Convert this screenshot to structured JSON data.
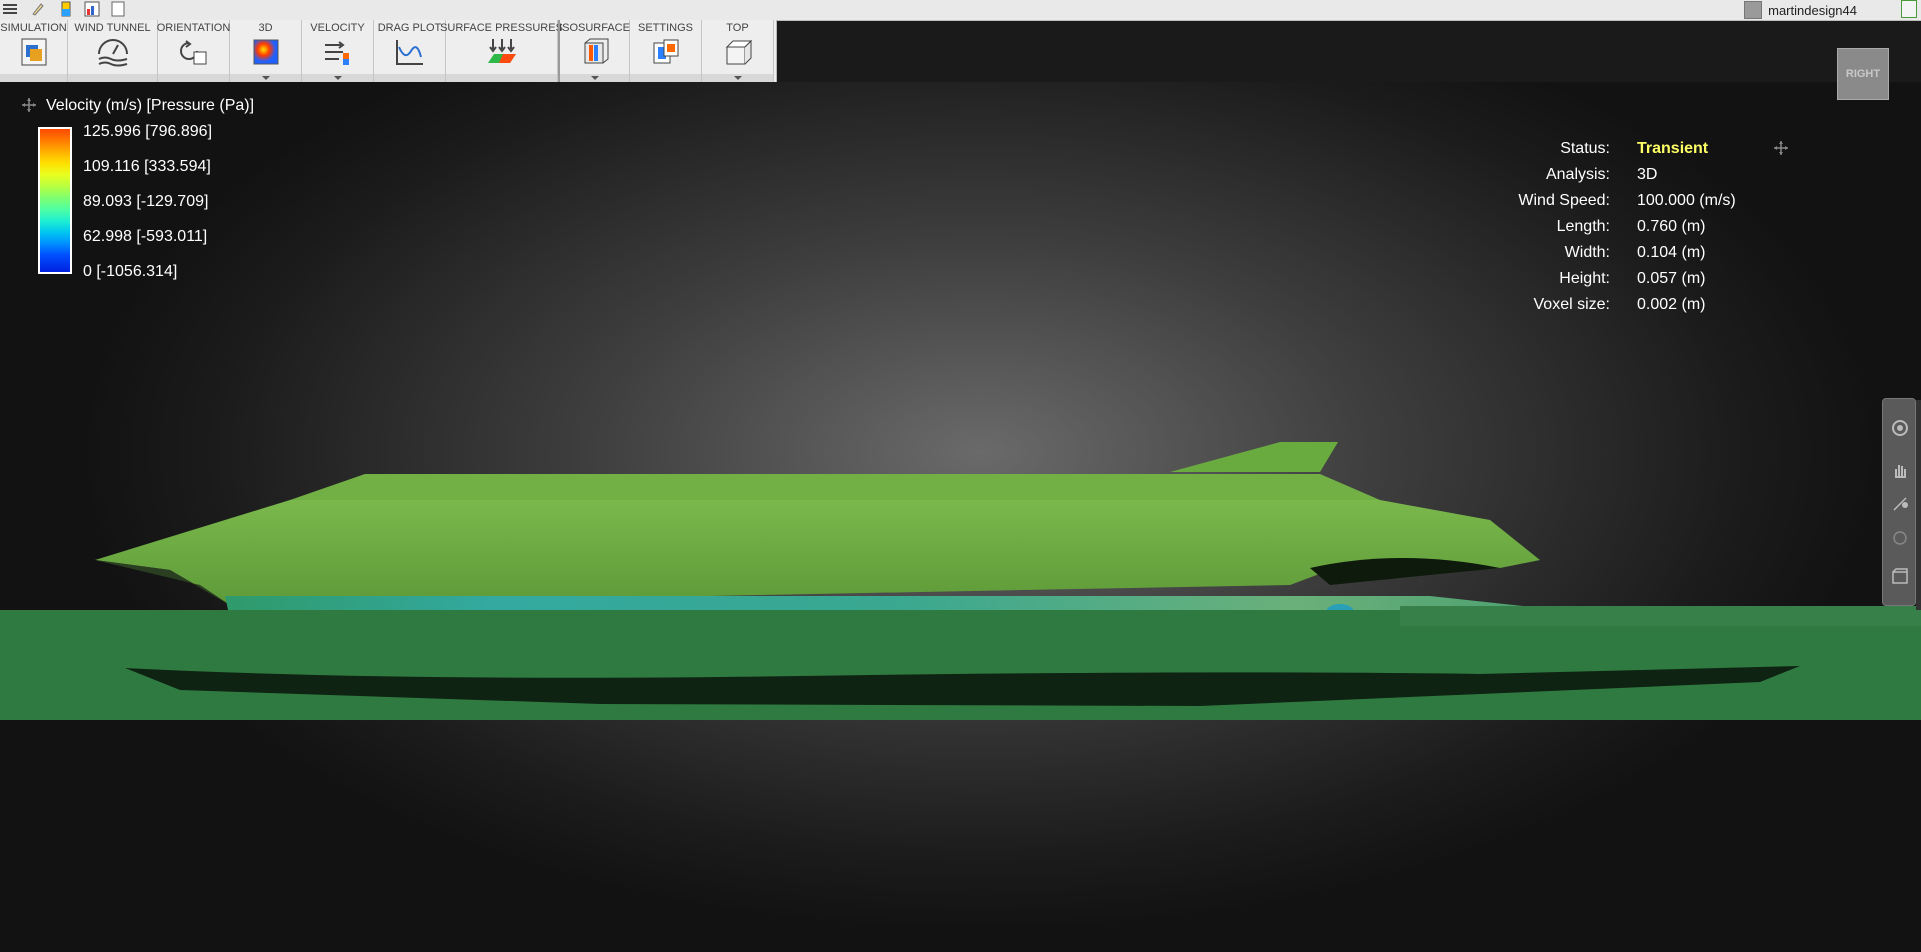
{
  "topbar": {
    "user": "martindesign44"
  },
  "ribbon": {
    "panels": [
      {
        "label": "SIMULATION",
        "icon": "simulation-icon",
        "dropdown": false
      },
      {
        "label": "WIND TUNNEL",
        "icon": "wind-tunnel-icon",
        "dropdown": false
      },
      {
        "label": "ORIENTATION",
        "icon": "orientation-icon",
        "dropdown": false
      },
      {
        "label": "3D",
        "icon": "3d-color-icon",
        "dropdown": true
      },
      {
        "label": "VELOCITY",
        "icon": "velocity-icon",
        "dropdown": true
      },
      {
        "label": "DRAG PLOT",
        "icon": "drag-plot-icon",
        "dropdown": false
      },
      {
        "label": "SURFACE PRESSURES",
        "icon": "surface-pressures-icon",
        "dropdown": false
      },
      {
        "label": "ISOSURFACE",
        "icon": "isosurface-icon",
        "dropdown": true
      },
      {
        "label": "SETTINGS",
        "icon": "settings-icon",
        "dropdown": false
      },
      {
        "label": "TOP",
        "icon": "top-view-icon",
        "dropdown": true
      }
    ]
  },
  "legend": {
    "title": "Velocity (m/s) [Pressure (Pa)]",
    "values": [
      "125.996 [796.896]",
      "109.116 [333.594]",
      "89.093 [-129.709]",
      "62.998 [-593.011]",
      "0 [-1056.314]"
    ]
  },
  "status_panel": {
    "rows": [
      {
        "key": "Status:",
        "value": "Transient"
      },
      {
        "key": "Analysis:",
        "value": "3D"
      },
      {
        "key": "Wind Speed:",
        "value": "100.000 (m/s)"
      },
      {
        "key": "Length:",
        "value": "0.760 (m)"
      },
      {
        "key": "Width:",
        "value": "0.104 (m)"
      },
      {
        "key": "Height:",
        "value": "0.057 (m)"
      },
      {
        "key": "Voxel size:",
        "value": "0.002 (m)"
      }
    ],
    "highlight_color": "#ffff66"
  },
  "viewcube": {
    "face": "RIGHT"
  },
  "navbar": {
    "tools": [
      "orbit-icon",
      "pan-icon",
      "zoom-icon",
      "look-icon",
      "viewcube-toggle-icon"
    ]
  },
  "colors": {
    "model_green": "#6aa842",
    "ground_green": "#378046",
    "ribbon_bg": "#eeeeee"
  }
}
